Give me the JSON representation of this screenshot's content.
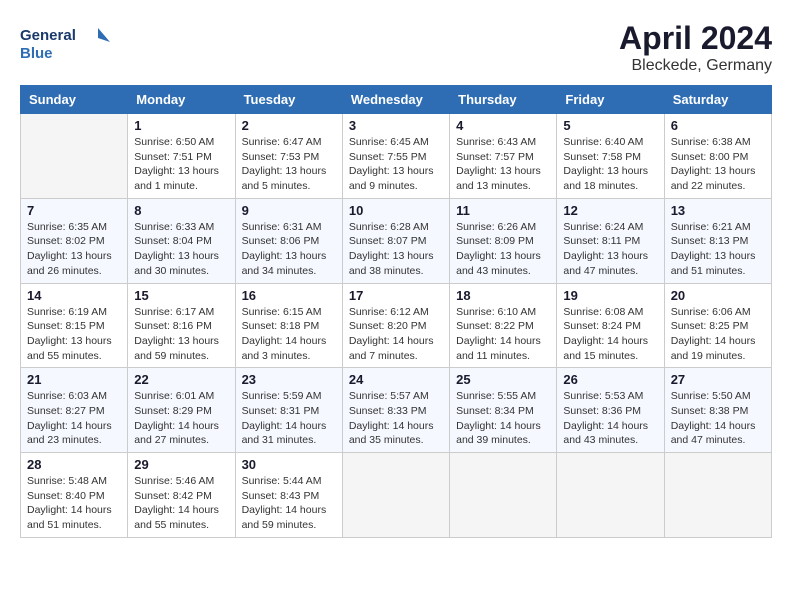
{
  "header": {
    "logo_line1": "General",
    "logo_line2": "Blue",
    "title": "April 2024",
    "subtitle": "Bleckede, Germany"
  },
  "days_of_week": [
    "Sunday",
    "Monday",
    "Tuesday",
    "Wednesday",
    "Thursday",
    "Friday",
    "Saturday"
  ],
  "weeks": [
    [
      {
        "day": "",
        "sunrise": "",
        "sunset": "",
        "daylight": ""
      },
      {
        "day": "1",
        "sunrise": "Sunrise: 6:50 AM",
        "sunset": "Sunset: 7:51 PM",
        "daylight": "Daylight: 13 hours and 1 minute."
      },
      {
        "day": "2",
        "sunrise": "Sunrise: 6:47 AM",
        "sunset": "Sunset: 7:53 PM",
        "daylight": "Daylight: 13 hours and 5 minutes."
      },
      {
        "day": "3",
        "sunrise": "Sunrise: 6:45 AM",
        "sunset": "Sunset: 7:55 PM",
        "daylight": "Daylight: 13 hours and 9 minutes."
      },
      {
        "day": "4",
        "sunrise": "Sunrise: 6:43 AM",
        "sunset": "Sunset: 7:57 PM",
        "daylight": "Daylight: 13 hours and 13 minutes."
      },
      {
        "day": "5",
        "sunrise": "Sunrise: 6:40 AM",
        "sunset": "Sunset: 7:58 PM",
        "daylight": "Daylight: 13 hours and 18 minutes."
      },
      {
        "day": "6",
        "sunrise": "Sunrise: 6:38 AM",
        "sunset": "Sunset: 8:00 PM",
        "daylight": "Daylight: 13 hours and 22 minutes."
      }
    ],
    [
      {
        "day": "7",
        "sunrise": "Sunrise: 6:35 AM",
        "sunset": "Sunset: 8:02 PM",
        "daylight": "Daylight: 13 hours and 26 minutes."
      },
      {
        "day": "8",
        "sunrise": "Sunrise: 6:33 AM",
        "sunset": "Sunset: 8:04 PM",
        "daylight": "Daylight: 13 hours and 30 minutes."
      },
      {
        "day": "9",
        "sunrise": "Sunrise: 6:31 AM",
        "sunset": "Sunset: 8:06 PM",
        "daylight": "Daylight: 13 hours and 34 minutes."
      },
      {
        "day": "10",
        "sunrise": "Sunrise: 6:28 AM",
        "sunset": "Sunset: 8:07 PM",
        "daylight": "Daylight: 13 hours and 38 minutes."
      },
      {
        "day": "11",
        "sunrise": "Sunrise: 6:26 AM",
        "sunset": "Sunset: 8:09 PM",
        "daylight": "Daylight: 13 hours and 43 minutes."
      },
      {
        "day": "12",
        "sunrise": "Sunrise: 6:24 AM",
        "sunset": "Sunset: 8:11 PM",
        "daylight": "Daylight: 13 hours and 47 minutes."
      },
      {
        "day": "13",
        "sunrise": "Sunrise: 6:21 AM",
        "sunset": "Sunset: 8:13 PM",
        "daylight": "Daylight: 13 hours and 51 minutes."
      }
    ],
    [
      {
        "day": "14",
        "sunrise": "Sunrise: 6:19 AM",
        "sunset": "Sunset: 8:15 PM",
        "daylight": "Daylight: 13 hours and 55 minutes."
      },
      {
        "day": "15",
        "sunrise": "Sunrise: 6:17 AM",
        "sunset": "Sunset: 8:16 PM",
        "daylight": "Daylight: 13 hours and 59 minutes."
      },
      {
        "day": "16",
        "sunrise": "Sunrise: 6:15 AM",
        "sunset": "Sunset: 8:18 PM",
        "daylight": "Daylight: 14 hours and 3 minutes."
      },
      {
        "day": "17",
        "sunrise": "Sunrise: 6:12 AM",
        "sunset": "Sunset: 8:20 PM",
        "daylight": "Daylight: 14 hours and 7 minutes."
      },
      {
        "day": "18",
        "sunrise": "Sunrise: 6:10 AM",
        "sunset": "Sunset: 8:22 PM",
        "daylight": "Daylight: 14 hours and 11 minutes."
      },
      {
        "day": "19",
        "sunrise": "Sunrise: 6:08 AM",
        "sunset": "Sunset: 8:24 PM",
        "daylight": "Daylight: 14 hours and 15 minutes."
      },
      {
        "day": "20",
        "sunrise": "Sunrise: 6:06 AM",
        "sunset": "Sunset: 8:25 PM",
        "daylight": "Daylight: 14 hours and 19 minutes."
      }
    ],
    [
      {
        "day": "21",
        "sunrise": "Sunrise: 6:03 AM",
        "sunset": "Sunset: 8:27 PM",
        "daylight": "Daylight: 14 hours and 23 minutes."
      },
      {
        "day": "22",
        "sunrise": "Sunrise: 6:01 AM",
        "sunset": "Sunset: 8:29 PM",
        "daylight": "Daylight: 14 hours and 27 minutes."
      },
      {
        "day": "23",
        "sunrise": "Sunrise: 5:59 AM",
        "sunset": "Sunset: 8:31 PM",
        "daylight": "Daylight: 14 hours and 31 minutes."
      },
      {
        "day": "24",
        "sunrise": "Sunrise: 5:57 AM",
        "sunset": "Sunset: 8:33 PM",
        "daylight": "Daylight: 14 hours and 35 minutes."
      },
      {
        "day": "25",
        "sunrise": "Sunrise: 5:55 AM",
        "sunset": "Sunset: 8:34 PM",
        "daylight": "Daylight: 14 hours and 39 minutes."
      },
      {
        "day": "26",
        "sunrise": "Sunrise: 5:53 AM",
        "sunset": "Sunset: 8:36 PM",
        "daylight": "Daylight: 14 hours and 43 minutes."
      },
      {
        "day": "27",
        "sunrise": "Sunrise: 5:50 AM",
        "sunset": "Sunset: 8:38 PM",
        "daylight": "Daylight: 14 hours and 47 minutes."
      }
    ],
    [
      {
        "day": "28",
        "sunrise": "Sunrise: 5:48 AM",
        "sunset": "Sunset: 8:40 PM",
        "daylight": "Daylight: 14 hours and 51 minutes."
      },
      {
        "day": "29",
        "sunrise": "Sunrise: 5:46 AM",
        "sunset": "Sunset: 8:42 PM",
        "daylight": "Daylight: 14 hours and 55 minutes."
      },
      {
        "day": "30",
        "sunrise": "Sunrise: 5:44 AM",
        "sunset": "Sunset: 8:43 PM",
        "daylight": "Daylight: 14 hours and 59 minutes."
      },
      {
        "day": "",
        "sunrise": "",
        "sunset": "",
        "daylight": ""
      },
      {
        "day": "",
        "sunrise": "",
        "sunset": "",
        "daylight": ""
      },
      {
        "day": "",
        "sunrise": "",
        "sunset": "",
        "daylight": ""
      },
      {
        "day": "",
        "sunrise": "",
        "sunset": "",
        "daylight": ""
      }
    ]
  ]
}
